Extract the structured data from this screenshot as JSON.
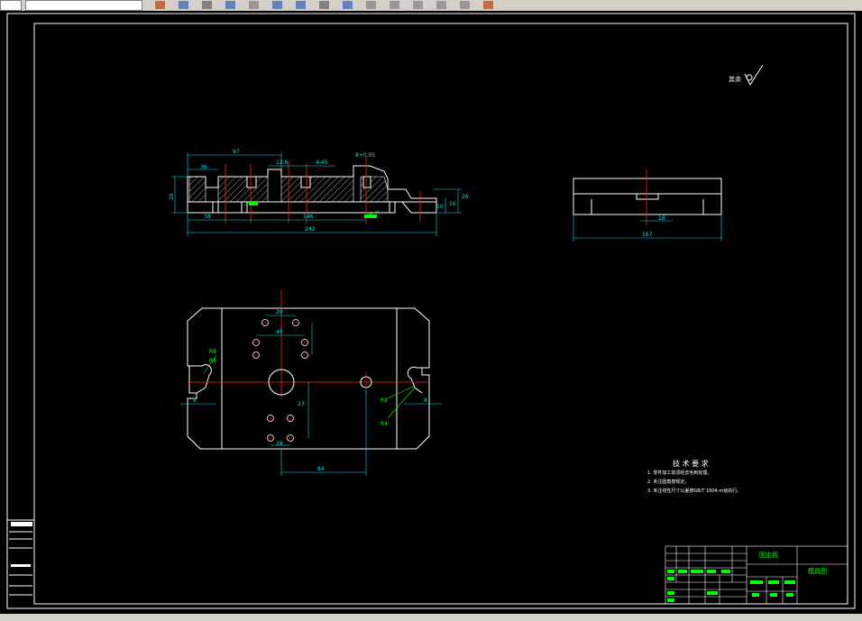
{
  "toolbar": {
    "buttons": [
      "layer-icon",
      "undo-icon",
      "pan-icon",
      "zoom-icon",
      "properties-icon",
      "arrow-icon",
      "refresh-icon",
      "grid-icon",
      "text-icon",
      "line-icon",
      "rect-icon",
      "insert-icon",
      "pin-icon",
      "move-icon",
      "brush-icon"
    ]
  },
  "drawing": {
    "roughness_note": "其余",
    "tech_title": "技 术 要 求",
    "tech_notes": [
      "1. 零件加工前须经去毛刺处理。",
      "2. 未注圆角按规定。",
      "3. 未注线性尺寸公差按GB/T 1804-m级执行。"
    ],
    "front_view_dims": {
      "d97": "97",
      "d36": "36",
      "d12_6": "12.6",
      "d4_45": "4-45",
      "d8_tol": "8+0.05",
      "d38": "38",
      "d146": "146",
      "d242": "242",
      "d10": "10",
      "d16": "16",
      "d26": "26"
    },
    "side_view_dims": {
      "d167": "167",
      "d18": "18"
    },
    "plan_view_dims": {
      "d20": "20",
      "d40": "40",
      "d28": "28",
      "d23": "23",
      "d84": "84",
      "r8": "R8",
      "r4": "R4",
      "d8": "8"
    },
    "title_block": {
      "part_name": "固定板",
      "drawing_no": "模具图"
    },
    "colors": {
      "outline": "#ffffff",
      "center": "#ff2020",
      "dimension": "#00e5e5",
      "note": "#00ff00",
      "hatch": "#ffffff"
    }
  }
}
